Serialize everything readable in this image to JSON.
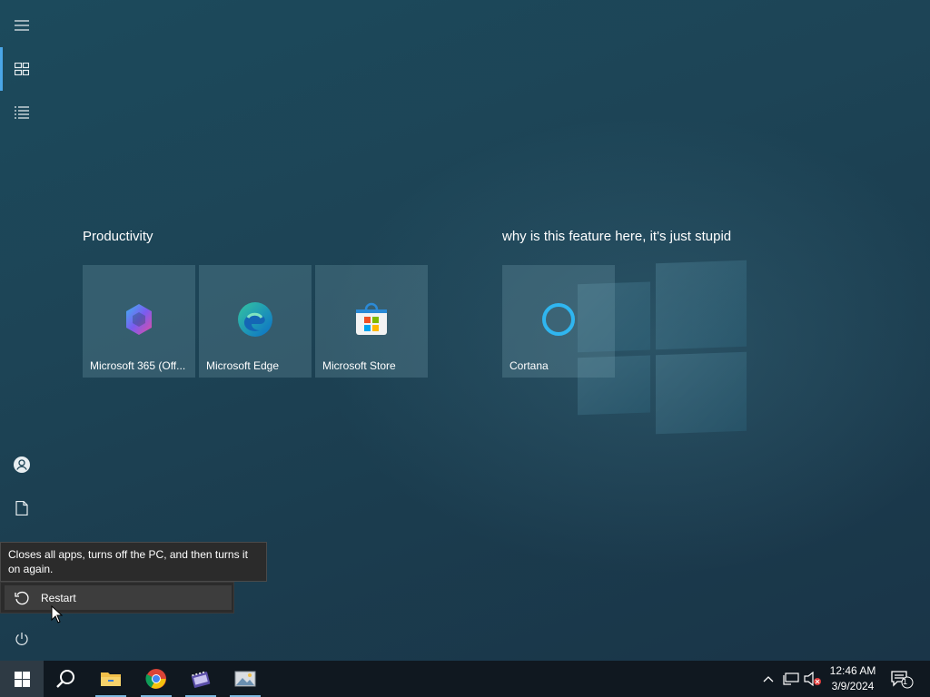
{
  "rail": {
    "items": [
      {
        "name": "expand",
        "icon": "hamburger-icon"
      },
      {
        "name": "pinned-tiles",
        "icon": "tiles-icon"
      },
      {
        "name": "all-apps",
        "icon": "list-icon"
      },
      {
        "name": "account",
        "icon": "user-icon"
      },
      {
        "name": "documents",
        "icon": "document-icon"
      },
      {
        "name": "power",
        "icon": "power-icon"
      }
    ]
  },
  "groups": [
    {
      "title": "Productivity",
      "tiles": [
        {
          "label": "Microsoft 365 (Off...",
          "icon": "microsoft-365-icon"
        },
        {
          "label": "Microsoft Edge",
          "icon": "edge-icon"
        },
        {
          "label": "Microsoft Store",
          "icon": "store-icon"
        }
      ]
    },
    {
      "title": "why is this feature here, it's just stupid",
      "tiles": [
        {
          "label": "Cortana",
          "icon": "cortana-icon"
        }
      ]
    }
  ],
  "power_menu": {
    "tooltip": "Closes all apps, turns off the PC, and then turns it on again.",
    "items": [
      {
        "label": "Restart",
        "icon": "restart-icon"
      }
    ]
  },
  "taskbar": {
    "apps": [
      {
        "name": "start",
        "icon": "windows-icon"
      },
      {
        "name": "search",
        "icon": "search-icon"
      },
      {
        "name": "file-explorer",
        "icon": "folder-icon"
      },
      {
        "name": "chrome",
        "icon": "chrome-icon"
      },
      {
        "name": "video-editor",
        "icon": "film-icon"
      },
      {
        "name": "image-viewer",
        "icon": "photos-icon"
      }
    ],
    "tray": {
      "time": "12:46 AM",
      "date": "3/9/2024",
      "notification_count": "1"
    }
  },
  "colors": {
    "accent": "#4aa6e8",
    "taskbar": "#101820",
    "tile": "#5d8796"
  }
}
